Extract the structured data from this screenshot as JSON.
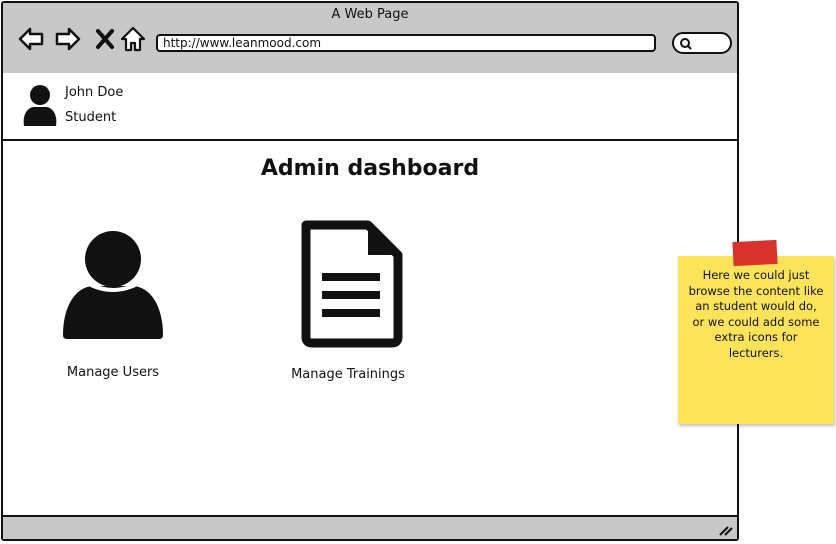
{
  "window": {
    "title": "A Web Page"
  },
  "browser": {
    "url": "http://www.leanmood.com"
  },
  "user": {
    "name": "John Doe",
    "role": "Student"
  },
  "page": {
    "title": "Admin dashboard"
  },
  "tiles": [
    {
      "label": "Manage Users",
      "icon": "user-icon"
    },
    {
      "label": "Manage Trainings",
      "icon": "document-icon"
    }
  ],
  "sticky_note": {
    "text": "Here we could just browse the content like an student would do, or we could add some extra icons for lecturers."
  },
  "colors": {
    "chrome": "#c8c8c8",
    "sticky": "#fbe35a",
    "tape": "#d9312c"
  }
}
